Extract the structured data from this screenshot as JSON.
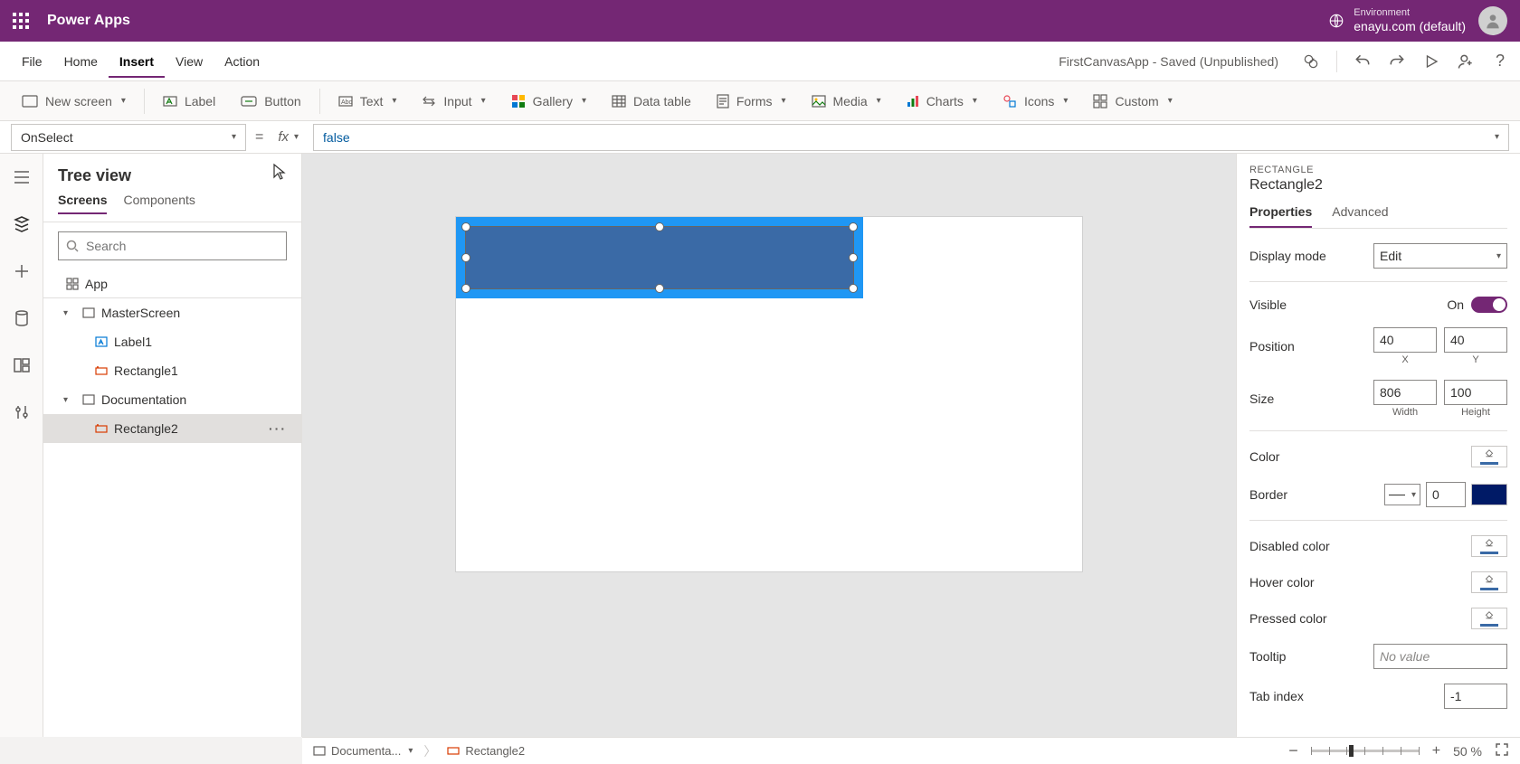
{
  "header": {
    "app_name": "Power Apps",
    "env_label": "Environment",
    "env_name": "enayu.com (default)"
  },
  "menubar": {
    "items": [
      "File",
      "Home",
      "Insert",
      "View",
      "Action"
    ],
    "active_index": 2,
    "doc_status": "FirstCanvasApp - Saved (Unpublished)"
  },
  "ribbon": {
    "new_screen": "New screen",
    "label": "Label",
    "button": "Button",
    "text": "Text",
    "input": "Input",
    "gallery": "Gallery",
    "data_table": "Data table",
    "forms": "Forms",
    "media": "Media",
    "charts": "Charts",
    "icons": "Icons",
    "custom": "Custom"
  },
  "formula": {
    "property": "OnSelect",
    "fx": "fx",
    "value": "false"
  },
  "tree": {
    "title": "Tree view",
    "tabs": [
      "Screens",
      "Components"
    ],
    "active_tab": 0,
    "search_placeholder": "Search",
    "app": "App",
    "items": [
      {
        "name": "MasterScreen",
        "children": [
          {
            "name": "Label1",
            "type": "label"
          },
          {
            "name": "Rectangle1",
            "type": "rect"
          }
        ]
      },
      {
        "name": "Documentation",
        "children": [
          {
            "name": "Rectangle2",
            "type": "rect",
            "selected": true
          }
        ]
      }
    ]
  },
  "props": {
    "type_label": "RECTANGLE",
    "name": "Rectangle2",
    "tabs": [
      "Properties",
      "Advanced"
    ],
    "active_tab": 0,
    "display_mode_label": "Display mode",
    "display_mode_value": "Edit",
    "visible_label": "Visible",
    "visible_value": "On",
    "position_label": "Position",
    "pos_x": "40",
    "pos_y": "40",
    "pos_x_lbl": "X",
    "pos_y_lbl": "Y",
    "size_label": "Size",
    "size_w": "806",
    "size_h": "100",
    "size_w_lbl": "Width",
    "size_h_lbl": "Height",
    "color_label": "Color",
    "border_label": "Border",
    "border_val": "0",
    "disabled_color_label": "Disabled color",
    "hover_color_label": "Hover color",
    "pressed_color_label": "Pressed color",
    "tooltip_label": "Tooltip",
    "tooltip_placeholder": "No value",
    "tabindex_label": "Tab index",
    "tabindex_value": "-1"
  },
  "statusbar": {
    "crumb1": "Documenta...",
    "crumb2": "Rectangle2",
    "zoom_value": "50",
    "zoom_unit": "%"
  }
}
